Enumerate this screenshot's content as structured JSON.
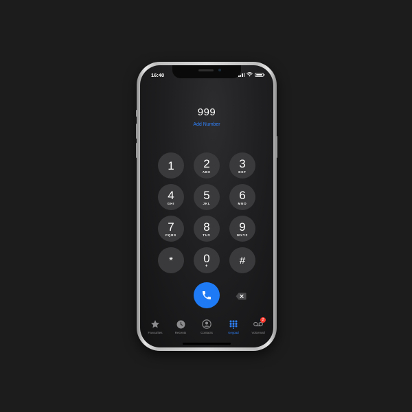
{
  "status_bar": {
    "time": "16:40"
  },
  "dialer": {
    "number": "999",
    "add_number_label": "Add Number"
  },
  "keypad": {
    "keys": [
      {
        "digit": "1",
        "letters": ""
      },
      {
        "digit": "2",
        "letters": "ABC"
      },
      {
        "digit": "3",
        "letters": "DEF"
      },
      {
        "digit": "4",
        "letters": "GHI"
      },
      {
        "digit": "5",
        "letters": "JKL"
      },
      {
        "digit": "6",
        "letters": "MNO"
      },
      {
        "digit": "7",
        "letters": "PQRS"
      },
      {
        "digit": "8",
        "letters": "TUV"
      },
      {
        "digit": "9",
        "letters": "WXYZ"
      },
      {
        "digit": "*",
        "letters": ""
      },
      {
        "digit": "0",
        "letters": "+"
      },
      {
        "digit": "#",
        "letters": ""
      }
    ]
  },
  "tab_bar": {
    "tabs": [
      {
        "label": "Favourites",
        "icon": "star-icon",
        "active": false
      },
      {
        "label": "Recents",
        "icon": "clock-icon",
        "active": false
      },
      {
        "label": "Contacts",
        "icon": "person-icon",
        "active": false
      },
      {
        "label": "Keypad",
        "icon": "keypad-grid-icon",
        "active": true
      },
      {
        "label": "Voicemail",
        "icon": "voicemail-icon",
        "active": false,
        "badge": "2"
      }
    ]
  },
  "colors": {
    "accent": "#2f82ff",
    "call_button": "#1f7bf5",
    "key_background": "#3a3a3c",
    "badge": "#ff3b30"
  }
}
